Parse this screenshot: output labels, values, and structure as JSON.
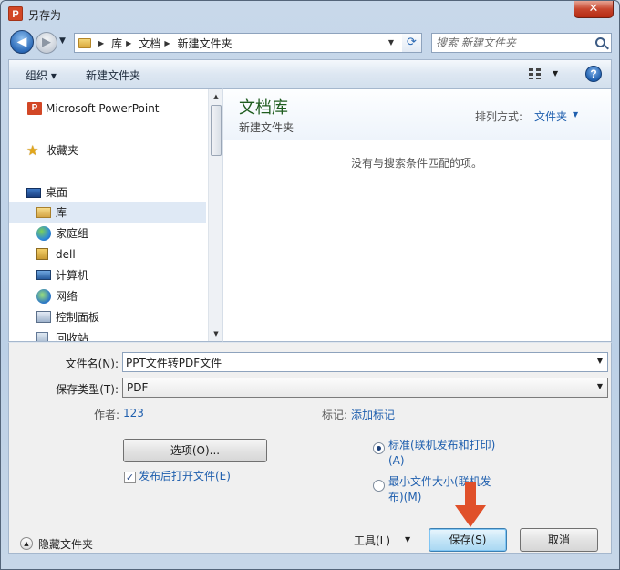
{
  "window": {
    "title": "另存为",
    "app_icon_letter": "P",
    "close_glyph": "✕"
  },
  "nav": {
    "breadcrumb": [
      "库",
      "文档",
      "新建文件夹"
    ],
    "search_placeholder": "搜索 新建文件夹"
  },
  "toolbar": {
    "organize_label": "组织 ▾",
    "new_folder_label": "新建文件夹",
    "help_glyph": "?"
  },
  "sidebar": {
    "items": [
      {
        "label": "Microsoft PowerPoint",
        "icon": "powerpoint-icon"
      },
      {
        "label": "收藏夹",
        "icon": "star-icon"
      },
      {
        "label": "桌面",
        "icon": "desktop-icon"
      },
      {
        "label": "库",
        "icon": "library-icon"
      },
      {
        "label": "家庭组",
        "icon": "homegroup-icon"
      },
      {
        "label": "dell",
        "icon": "user-folder-icon"
      },
      {
        "label": "计算机",
        "icon": "computer-icon"
      },
      {
        "label": "网络",
        "icon": "network-icon"
      },
      {
        "label": "控制面板",
        "icon": "control-panel-icon"
      },
      {
        "label": "回收站",
        "icon": "recycle-bin-icon"
      }
    ]
  },
  "content": {
    "library_title": "文档库",
    "library_subtitle": "新建文件夹",
    "arrange_label": "排列方式:",
    "arrange_value": "文件夹",
    "empty_message": "没有与搜索条件匹配的项。"
  },
  "form": {
    "filename_label": "文件名(N):",
    "filename_value": "PPT文件转PDF文件",
    "filetype_label": "保存类型(T):",
    "filetype_value": "PDF",
    "author_label": "作者:",
    "author_value": "123",
    "tags_label": "标记:",
    "tags_value": "添加标记",
    "options_button": "选项(O)...",
    "open_after_publish_label": "发布后打开文件(E)",
    "optimize_standard_line1": "标准(联机发布和打印)",
    "optimize_standard_line2": "(A)",
    "optimize_min_line1": "最小文件大小(联机发",
    "optimize_min_line2": "布)(M)"
  },
  "footer": {
    "hide_folders_label": "隐藏文件夹",
    "tools_label": "工具(L)",
    "save_label": "保存(S)",
    "cancel_label": "取消"
  },
  "colors": {
    "accent": "#1f5fae",
    "library_title": "#1e5c1e",
    "annotation_arrow": "#e0502a"
  }
}
